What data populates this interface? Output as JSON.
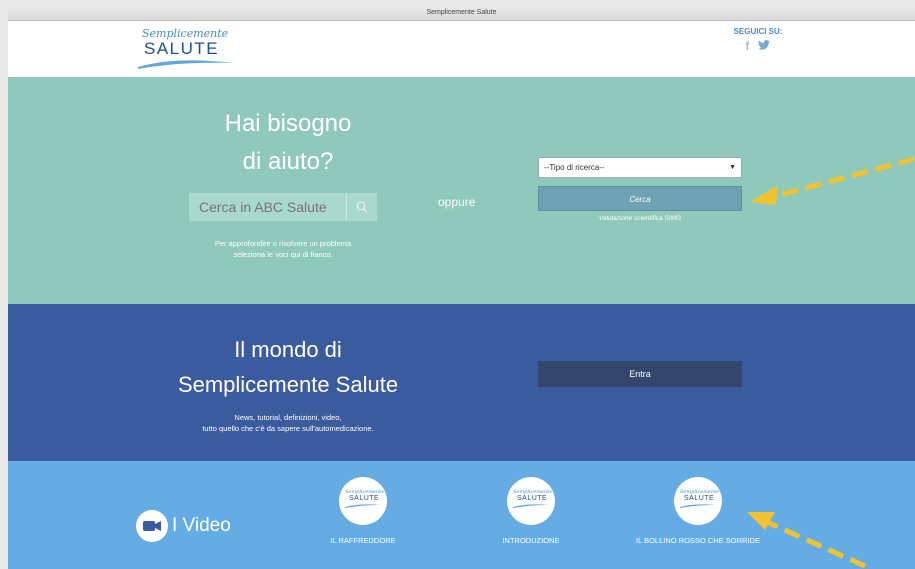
{
  "window": {
    "title": "Semplicemente Salute"
  },
  "header": {
    "logo_script": "Semplicemente",
    "logo_main": "SALUTE",
    "follow_label": "SEGUICI SU:",
    "social": [
      "f",
      "🐦"
    ]
  },
  "help": {
    "title_line1": "Hai bisogno",
    "title_line2": "di aiuto?",
    "search_placeholder": "Cerca in ABC Salute",
    "note_line1": "Per approfondire o risolvere un problema",
    "note_line2": "seleziona le voci qui di fianco.",
    "oppure": "oppure",
    "select_value": "--Tipo di ricerca--",
    "cerca_label": "Cerca",
    "validation": "Validazione scientifica SIMG"
  },
  "world": {
    "title_line1": "Il mondo di",
    "title_line2": "Semplicemente Salute",
    "sub_line1": "News, tutorial, definizioni, video,",
    "sub_line2": "tutto quello che c'è da sapere sull'automedicazione.",
    "enter_label": "Entra"
  },
  "videos": {
    "heading": "I Video",
    "items": [
      {
        "title": "IL RAFFREDDORE"
      },
      {
        "title": "INTRODUZIONE"
      },
      {
        "title": "IL BOLLINO ROSSO CHE SORRIDE"
      }
    ],
    "thumb_script": "Semplicemente",
    "thumb_main": "SALUTE"
  },
  "colors": {
    "help_bg": "#8ec9bb",
    "world_bg": "#3a5b9e",
    "videos_bg": "#65ace5",
    "annotation_arrow": "#f2c230"
  }
}
